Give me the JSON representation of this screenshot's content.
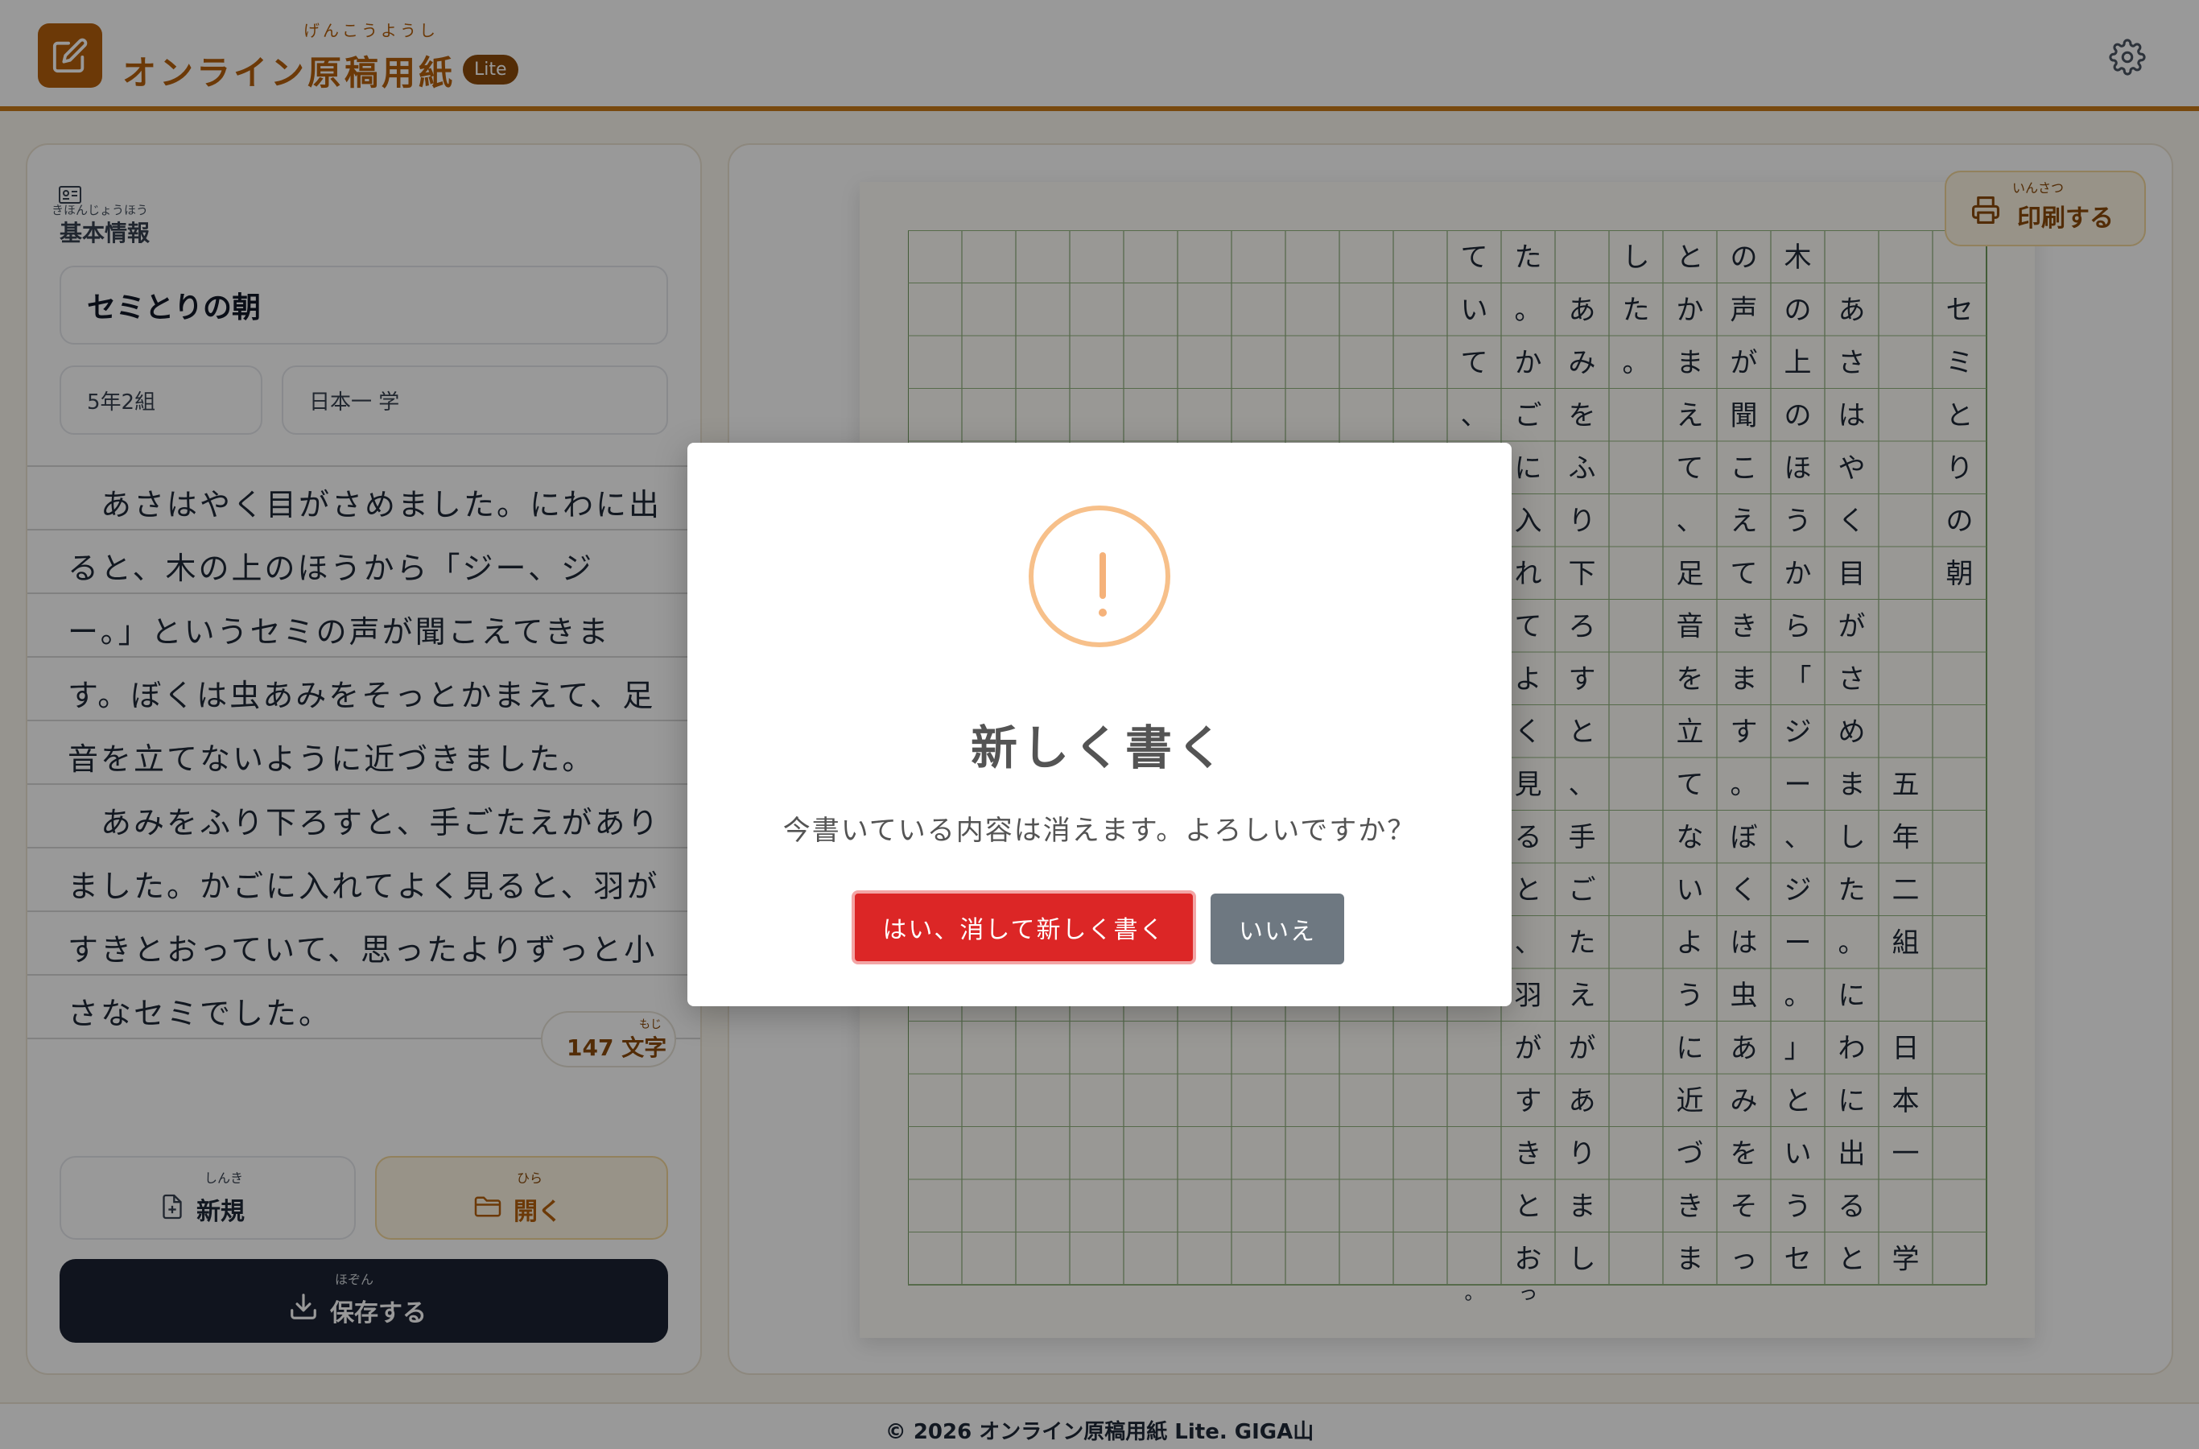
{
  "header": {
    "title": "オンライン原稿用紙",
    "title_ruby": "げんこうようし",
    "badge": "Lite"
  },
  "info": {
    "section_title": "基本情報",
    "section_ruby": "きほんじょうほう",
    "essay_title": "セミとりの朝",
    "class": "5年2組",
    "name": "日本一 学"
  },
  "essay": {
    "lines": [
      "　あさはやく目がさめました。にわに出",
      "ると、木の上のほうから「ジー、ジ",
      "ー。」というセミの声が聞こえてきま",
      "す。ぼくは虫あみをそっとかまえて、足",
      "音を立てないように近づきました。",
      "　あみをふり下ろすと、手ごたえがあり",
      "ました。かごに入れてよく見ると、羽が",
      "すきとおっていて、思ったよりずっと小",
      "さなセミでした。"
    ],
    "char_count": "147 文字",
    "char_count_ruby": "もじ"
  },
  "buttons": {
    "new_label": "新規",
    "new_ruby": "しんき",
    "open_label": "開く",
    "open_ruby": "ひら",
    "save_label": "保存する",
    "save_ruby": "ほぞん",
    "print_label": "印刷する",
    "print_ruby": "いんさつ"
  },
  "manuscript": {
    "columns": [
      "　セミとりの朝",
      "　　　　　　　　　　五年二組　日本一　学",
      "　あさはやく目がさめました。にわに出ると、",
      "木の上のほうから「ジー、ジー。」というセミ",
      "の声が聞こえてきます。ぼくは虫あみをそっ",
      "とかまえて、足音を立てないように近づきま",
      "した。",
      "　あみをふり下ろすと、手ごたえがありまし",
      "た。かごに入れてよく見ると、羽がすきとおっ",
      "ていて、"
    ],
    "trailing_chars": [
      {
        "col": 8,
        "char": "っ"
      },
      {
        "col": 9,
        "char": "。"
      }
    ]
  },
  "footer": {
    "text": "© 2026 オンライン原稿用紙 Lite. GIGA山"
  },
  "modal": {
    "title": "新しく書く",
    "message": "今書いている内容は消えます。よろしいですか？",
    "confirm_label": "はい、消して新しく書く",
    "cancel_label": "いいえ"
  },
  "colors": {
    "brand": "#b5600c",
    "danger": "#dc2626",
    "warning": "#f5b27a",
    "dark": "#1b2232"
  }
}
